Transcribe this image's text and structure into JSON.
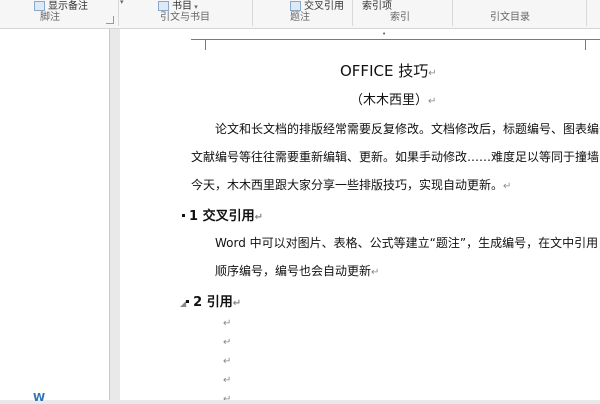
{
  "ribbon": {
    "top_items": [
      {
        "label": "显示备注"
      },
      {
        "label": "书目"
      },
      {
        "label": "交叉引用"
      },
      {
        "label": "索引项"
      }
    ],
    "groups": [
      "脚注",
      "引文与书目",
      "题注",
      "索引",
      "引文目录"
    ]
  },
  "document": {
    "title": "OFFICE 技巧",
    "subtitle": "（木木西里）",
    "para1_line1": "论文和长文档的排版经常需要反复修改。文档修改后，标题编号、图表编号、",
    "para1_line2": "文献编号等往往需要重新编辑、更新。如果手动修改……难度足以等同于撞墙！",
    "para2": "今天，木木西里跟大家分享一些排版技巧，实现自动更新。",
    "heading1": "1 交叉引用",
    "h1_para_line1": "Word 中可以对图片、表格、公式等建立“题注”，生成编号，在文中引用，",
    "h1_para_line2": "顺序编号，编号也会自动更新",
    "heading2": "2 引用",
    "para_mark": "↵"
  },
  "nav_pane": {
    "bottom_text": "W"
  }
}
